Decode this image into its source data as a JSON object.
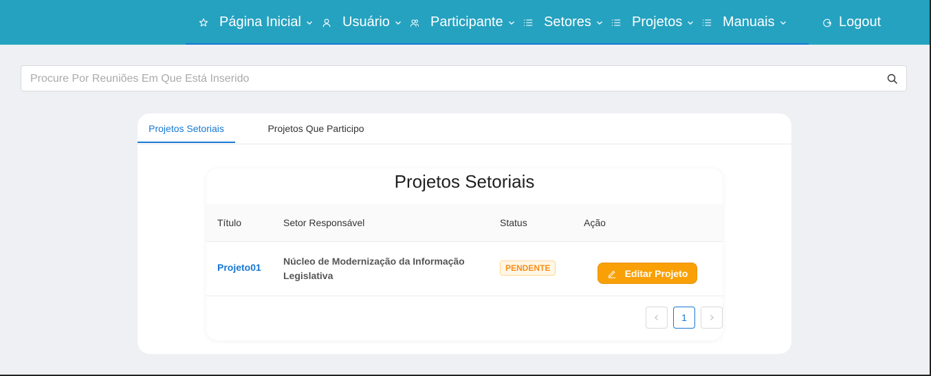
{
  "nav": {
    "items": [
      {
        "label": "Página Inicial",
        "icon": "star-icon"
      },
      {
        "label": "Usuário",
        "icon": "user-icon"
      },
      {
        "label": "Participante",
        "icon": "team-icon"
      },
      {
        "label": "Setores",
        "icon": "list-icon"
      },
      {
        "label": "Projetos",
        "icon": "list-icon"
      },
      {
        "label": "Manuais",
        "icon": "list-icon"
      }
    ],
    "logout_label": "Logout",
    "colors": {
      "bar": "#25a2c0",
      "accent": "#1677d2"
    }
  },
  "search": {
    "placeholder": "Procure Por Reuniões Em Que Está Inserido"
  },
  "tabs": [
    {
      "label": "Projetos Setoriais",
      "active": true
    },
    {
      "label": "Projetos Que Participo",
      "active": false
    }
  ],
  "panel": {
    "title": "Projetos Setoriais",
    "columns": [
      "Título",
      "Setor Responsável",
      "Status",
      "Ação"
    ],
    "rows": [
      {
        "titulo": "Projeto01",
        "setor": "Núcleo de Modernização da Informação Legislativa",
        "status": "PENDENTE",
        "acao": "Editar Projeto"
      }
    ]
  },
  "pagination": {
    "current": "1"
  }
}
